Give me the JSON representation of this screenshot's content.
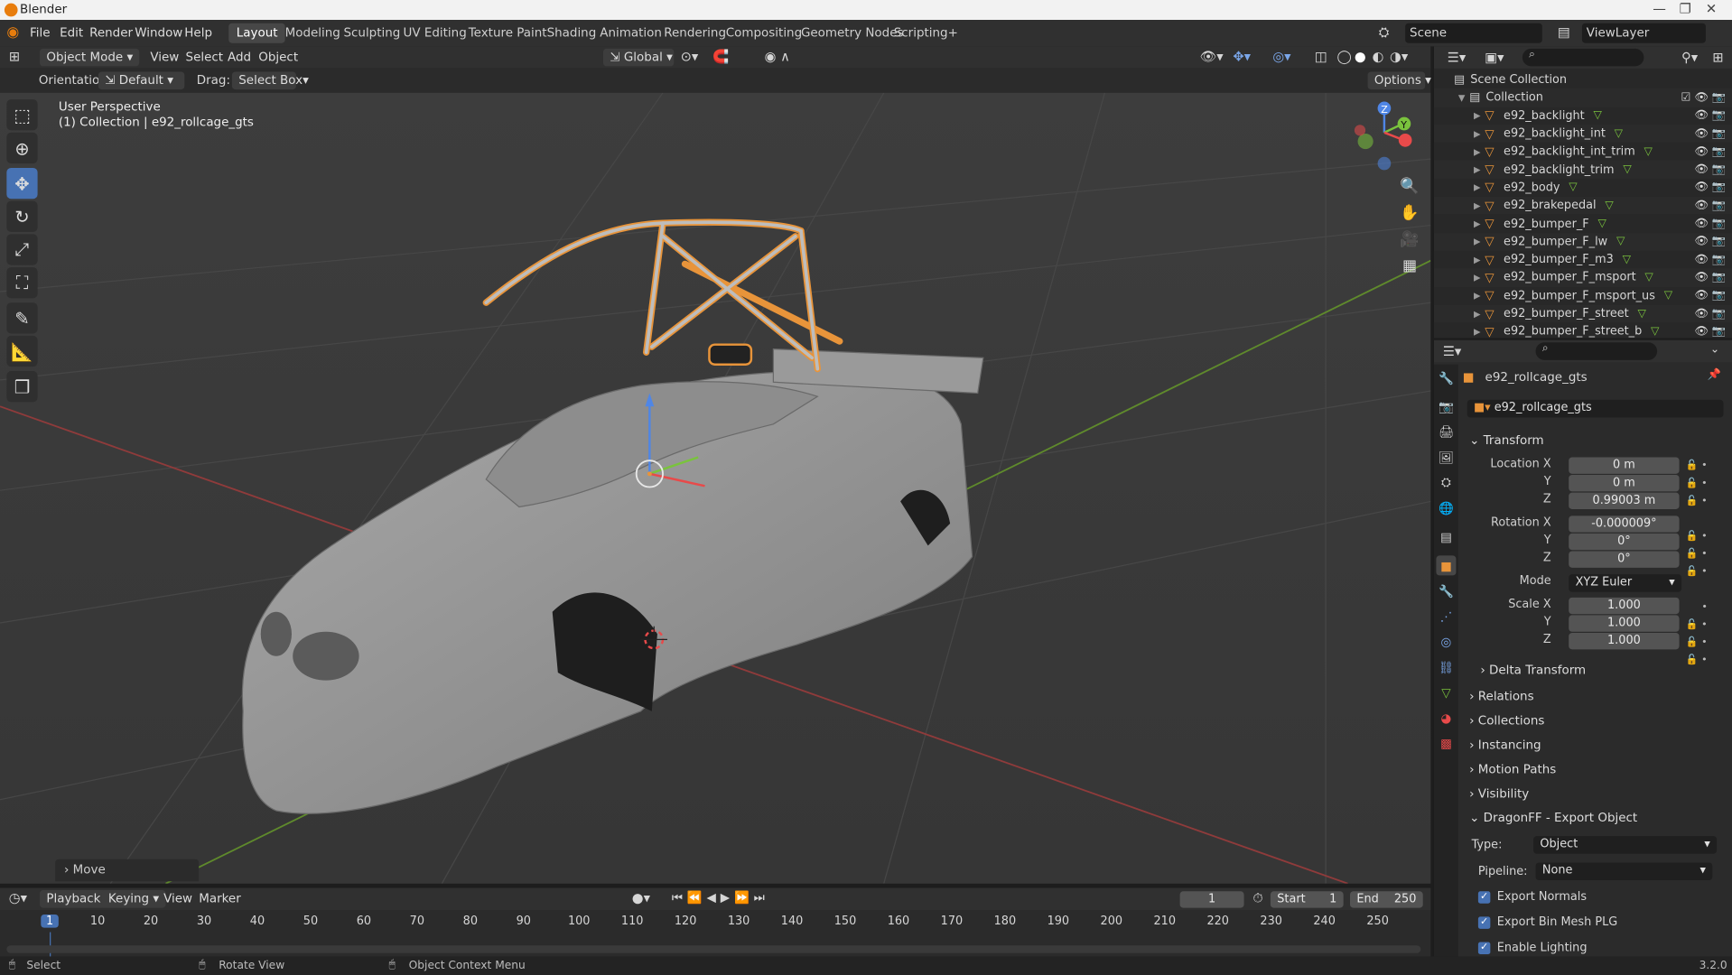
{
  "app": {
    "title": "Blender",
    "version": "3.2.0"
  },
  "menus": [
    "File",
    "Edit",
    "Render",
    "Window",
    "Help"
  ],
  "workspaces": [
    "Layout",
    "Modeling",
    "Sculpting",
    "UV Editing",
    "Texture Paint",
    "Shading",
    "Animation",
    "Rendering",
    "Compositing",
    "Geometry Nodes",
    "Scripting"
  ],
  "active_workspace": "Layout",
  "scene": "Scene",
  "view_layer": "ViewLayer",
  "viewport_header": {
    "mode": "Object Mode",
    "menus": [
      "View",
      "Select",
      "Add",
      "Object"
    ],
    "transform_orientation": "Global",
    "orientation_label": "Orientation:",
    "orientation_value": "Default",
    "drag_label": "Drag:",
    "drag_value": "Select Box",
    "options": "Options"
  },
  "viewport": {
    "perspective": "User Perspective",
    "context": "(1) Collection | e92_rollcage_gts",
    "last_op": "Move",
    "gizmo": {
      "z": "Z",
      "y": "Y"
    }
  },
  "outliner": {
    "root": "Scene Collection",
    "collection": "Collection",
    "items": [
      "e92_backlight",
      "e92_backlight_int",
      "e92_backlight_int_trim",
      "e92_backlight_trim",
      "e92_body",
      "e92_brakepedal",
      "e92_bumper_F",
      "e92_bumper_F_lw",
      "e92_bumper_F_m3",
      "e92_bumper_F_msport",
      "e92_bumper_F_msport_us",
      "e92_bumper_F_street",
      "e92_bumper_F_street_b"
    ]
  },
  "properties": {
    "object_name": "e92_rollcage_gts",
    "datablock": "e92_rollcage_gts",
    "transform": {
      "title": "Transform",
      "location_label": "Location X",
      "location": [
        "0 m",
        "0 m",
        "0.99003 m"
      ],
      "rotation_label": "Rotation X",
      "rotation": [
        "-0.000009°",
        "0°",
        "0°"
      ],
      "mode_label": "Mode",
      "mode": "XYZ Euler",
      "scale_label": "Scale X",
      "scale": [
        "1.000",
        "1.000",
        "1.000"
      ],
      "y": "Y",
      "z": "Z"
    },
    "subpanels": [
      "Delta Transform"
    ],
    "panels": [
      "Relations",
      "Collections",
      "Instancing",
      "Motion Paths",
      "Visibility"
    ],
    "dragonff": {
      "title": "DragonFF - Export Object",
      "type_label": "Type:",
      "type": "Object",
      "pipeline_label": "Pipeline:",
      "pipeline": "None",
      "export_normals": "Export Normals",
      "export_bin_mesh": "Export Bin Mesh PLG",
      "enable_lighting": "Enable Lighting"
    }
  },
  "timeline": {
    "menus": [
      "Playback",
      "Keying",
      "View",
      "Marker"
    ],
    "current_frame": "1",
    "start_label": "Start",
    "start": "1",
    "end_label": "End",
    "end": "250",
    "ticks": [
      "1",
      "10",
      "20",
      "30",
      "40",
      "50",
      "60",
      "70",
      "80",
      "90",
      "100",
      "110",
      "120",
      "130",
      "140",
      "150",
      "160",
      "170",
      "180",
      "190",
      "200",
      "210",
      "220",
      "230",
      "240",
      "250"
    ]
  },
  "statusbar": {
    "select": "Select",
    "rotate": "Rotate View",
    "context_menu": "Object Context Menu"
  },
  "colors": {
    "accent": "#4772b3",
    "selection": "#e8943a",
    "grid_red": "#b33c3c",
    "grid_green": "#6b9e2b"
  }
}
